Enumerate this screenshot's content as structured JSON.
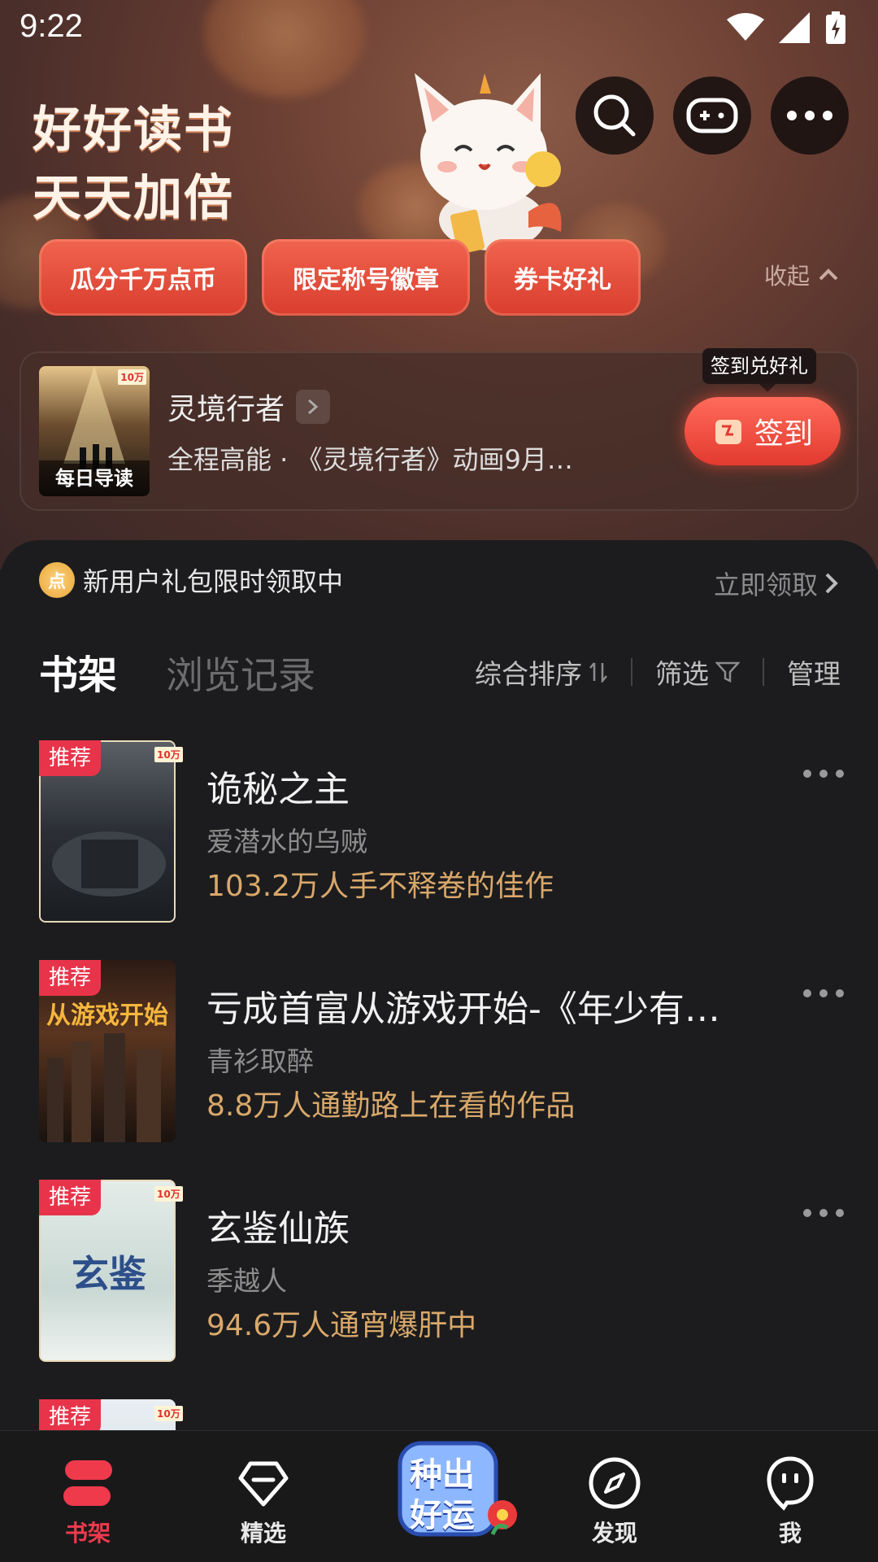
{
  "status_bar": {
    "time": "9:22"
  },
  "hero": {
    "headline_line1": "好好读书",
    "headline_line2": "天天加倍",
    "pills": [
      "瓜分千万点币",
      "限定称号徽章",
      "券卡好礼"
    ],
    "collapse_label": "收起"
  },
  "daily_card": {
    "cover_badge": "10万",
    "cover_label": "每日导读",
    "title": "灵境行者",
    "subtitle": "全程高能 · 《灵境行者》动画9月…",
    "tooltip": "签到兑好礼",
    "checkin_label": "签到"
  },
  "promo": {
    "coin_glyph": "点",
    "text": "新用户礼包限时领取中",
    "link": "立即领取"
  },
  "tabs": {
    "active": "书架",
    "inactive": "浏览记录"
  },
  "tools": {
    "sort": "综合排序",
    "filter": "筛选",
    "manage": "管理"
  },
  "books": [
    {
      "badge": "推荐",
      "corner": "10万",
      "title": "诡秘之主",
      "author": "爱潜水的乌贼",
      "desc": "103.2万人手不释卷的佳作"
    },
    {
      "badge": "推荐",
      "corner": "",
      "title": "亏成首富从游戏开始-《年少有…",
      "author": "青衫取醉",
      "desc": "8.8万人通勤路上在看的作品"
    },
    {
      "badge": "推荐",
      "corner": "10万",
      "title": "玄鉴仙族",
      "author": "季越人",
      "desc": "94.6万人通宵爆肝中"
    },
    {
      "badge": "推荐",
      "corner": "10万",
      "title": "",
      "author": "",
      "desc": ""
    }
  ],
  "nav": {
    "shelf": "书架",
    "featured": "精选",
    "badge_line1": "种出",
    "badge_line2": "好运",
    "discover": "发现",
    "me": "我"
  },
  "colors": {
    "accent": "#e8344a",
    "gold_text": "#d9a86a",
    "pill": "#e44a38"
  }
}
